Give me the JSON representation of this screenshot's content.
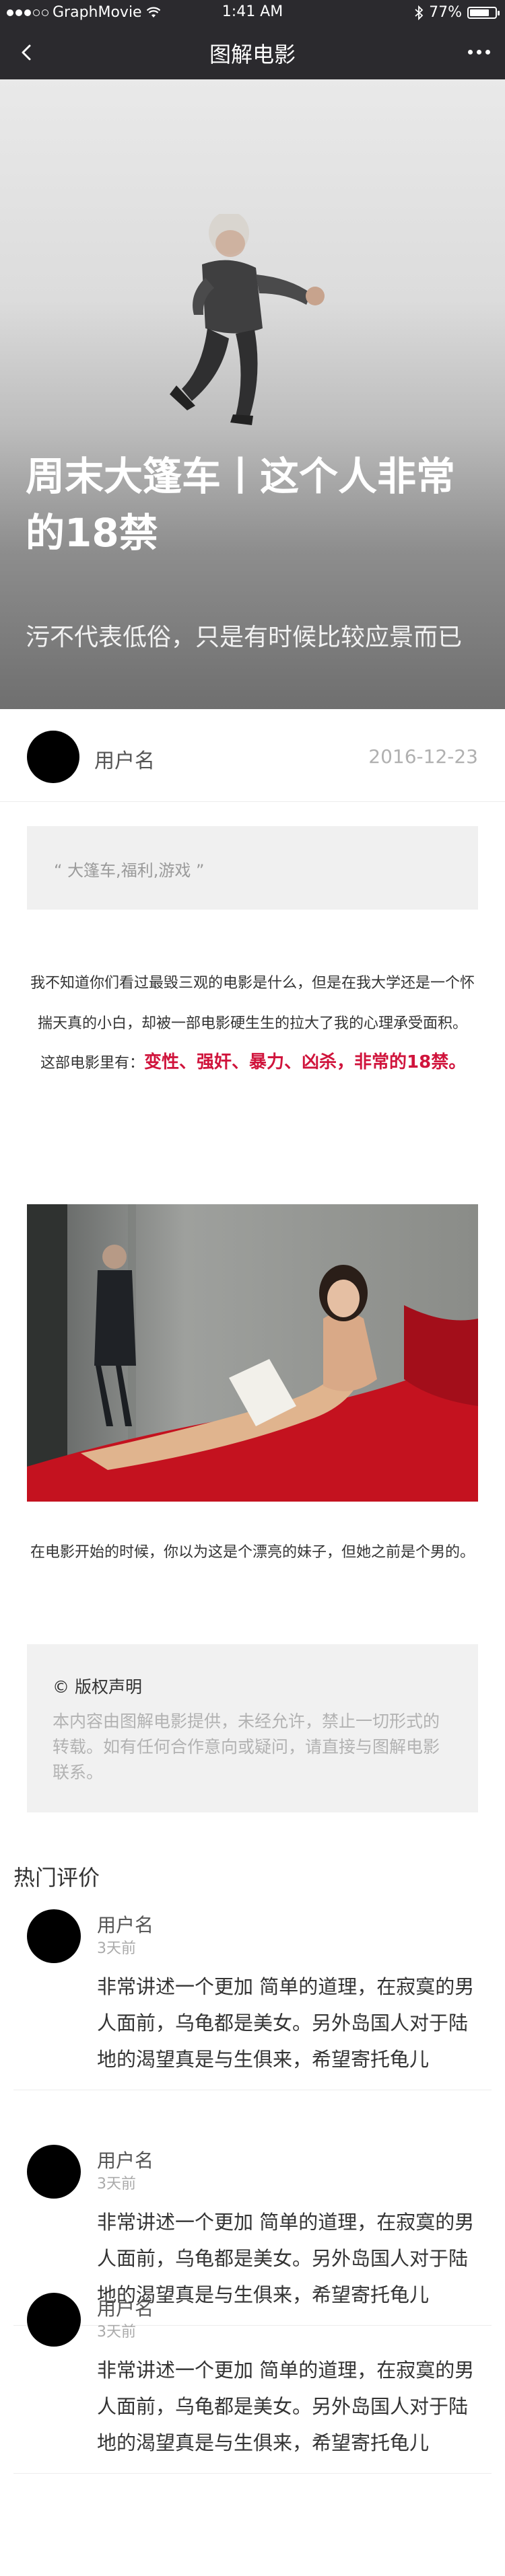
{
  "status_bar": {
    "carrier": "GraphMovie",
    "time": "1:41 AM",
    "battery": "77%",
    "battery_level": 0.77
  },
  "nav": {
    "title": "图解电影",
    "back_icon": "chevron-left-icon",
    "more_icon": "more-dots-icon"
  },
  "hero": {
    "title": "周末大篷车丨这个人非常的18禁",
    "subtitle": "污不代表低俗，只是有时候比较应景而已"
  },
  "author": {
    "name": "用户名",
    "date": "2016-12-23"
  },
  "tags": "“ 大篷车,福利,游戏 ”",
  "article": {
    "para1": "我不知道你们看过最毁三观的电影是什么，但是在我大学还是一个怀揣天真的小白，却被一部电影硬生生的拉大了我的心理承受面积。",
    "highlight_lead": "这部电影里有：",
    "highlight_red": "变性、强奸、暴力、凶杀，非常的18禁。",
    "para2": "在电影开始的时候，你以为这是个漂亮的妹子，但她之前是个男的。"
  },
  "copyright": {
    "heading": "© 版权声明",
    "body": "本内容由图解电影提供，未经允许，禁止一切形式的转载。如有任何合作意向或疑问，请直接与图解电影联系。"
  },
  "hot_comments": {
    "title": "热门评价",
    "items": [
      {
        "name": "用户名",
        "time": "3天前",
        "content": "非常讲述一个更加 简单的道理，在寂寞的男人面前，乌龟都是美女。另外岛国人对于陆地的渴望真是与生俱来，希望寄托龟儿"
      },
      {
        "name": "用户名",
        "time": "3天前",
        "content": "非常讲述一个更加 简单的道理，在寂寞的男人面前，乌龟都是美女。另外岛国人对于陆地的渴望真是与生俱来，希望寄托龟儿"
      },
      {
        "name": "用户名",
        "time": "3天前",
        "content": "非常讲述一个更加 简单的道理，在寂寞的男人面前，乌龟都是美女。另外岛国人对于陆地的渴望真是与生俱来，希望寄托龟儿"
      }
    ]
  },
  "colors": {
    "nav_bg": "#2b2a2e",
    "highlight": "#d0143c",
    "panel_bg": "#f0f0f0"
  }
}
